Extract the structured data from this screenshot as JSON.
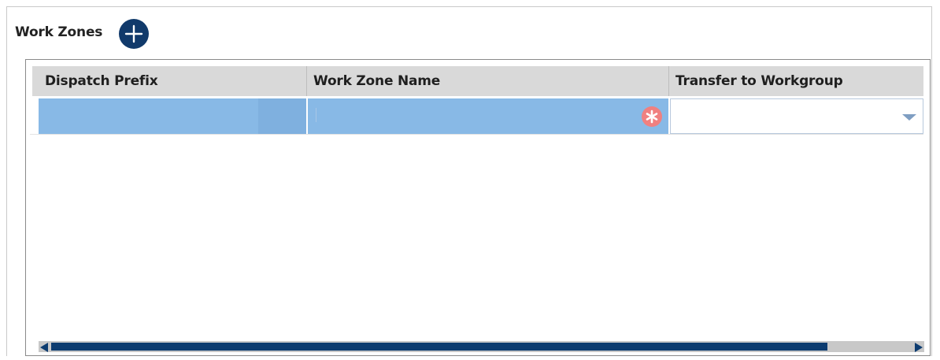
{
  "section": {
    "title": "Work Zones",
    "add_icon": "plus-circle-icon"
  },
  "grid": {
    "columns": [
      {
        "label": "Dispatch Prefix"
      },
      {
        "label": "Work Zone Name"
      },
      {
        "label": "Transfer to Workgroup"
      }
    ],
    "rows": [
      {
        "dispatch_prefix": "",
        "work_zone_name": "",
        "work_zone_name_required_icon": "required-asterisk-icon",
        "transfer_to_workgroup": "",
        "transfer_dropdown_icon": "chevron-down-icon"
      }
    ]
  },
  "colors": {
    "accent_dark_blue": "#113a6b",
    "selected_cell": "#88b9e6",
    "required_icon": "#f08080",
    "header_bg": "#d9d9d9",
    "scrollbar_thumb": "#0d3c70"
  }
}
